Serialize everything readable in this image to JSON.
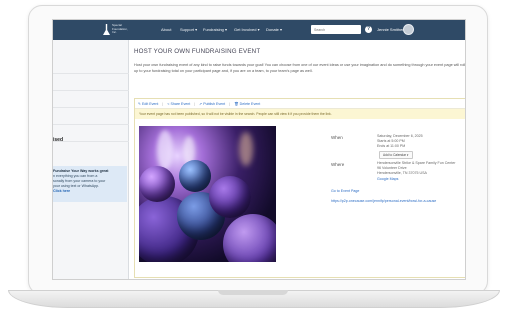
{
  "nav": {
    "logo_text": "Special Foundation, Inc.",
    "items": [
      "About",
      "Support ▾",
      "Fundraising ▾",
      "Get Involved ▾",
      "Donate ▾"
    ],
    "search_placeholder": "Search",
    "user_name": "Jennie Smithers"
  },
  "sidebar": {
    "active_label": "ised",
    "promo_title": "Fundraise Your Way works great",
    "promo_body": "n everything you can from a\nsonally from your camera to your\nyour using text or WhatsApp.",
    "promo_link": "Click here"
  },
  "main": {
    "title": "HOST YOUR OWN FUNDRAISING EVENT",
    "intro": "Host your own fundraising event of any kind to raise funds towards your goal! You can choose from one of our event ideas or use your imagination and do something through your event page will roll up to your fundraising total on your participant page and, if you are on a team, to your team's page as well.",
    "actions": [
      "Edit Event",
      "Share Event",
      "Publish Event",
      "Delete Event"
    ],
    "notice": "Your event page has not been published, so it will not be visible in the search. People can still view it if you provide them the link.",
    "when_label": "When",
    "when_lines": [
      "Saturday, December 6, 2025",
      "Starts at 5:00 PM",
      "Ends at 11:00 PM"
    ],
    "calendar_button": "Add to Calendar ▾",
    "where_label": "Where",
    "where_lines": [
      "Hendersonville Strike & Spare Family Fun Center",
      "96 Volunteer Drive",
      "Hendersonville, TN 37075 USA"
    ],
    "map_link": "Google Maps",
    "event_page_link": "Go to Event Page",
    "event_url": "https://p2p.onecause.com/jennifp/personal-event/bowl-for-a-cause"
  }
}
